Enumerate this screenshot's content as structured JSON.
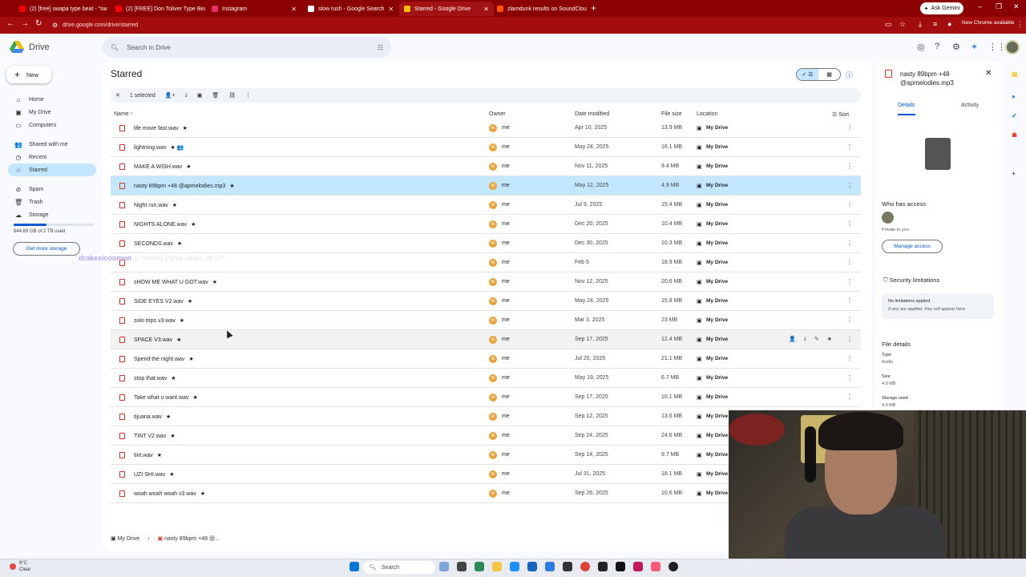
{
  "browser": {
    "tabs": [
      {
        "label": "(2) [free] swapa type beat - \"sw",
        "color": "#ff0000"
      },
      {
        "label": "(2) [FREE] Don Toliver Type Beat",
        "color": "#ff0000"
      },
      {
        "label": "Instagram",
        "color": "#e1306c"
      },
      {
        "label": "slow rush - Google Search",
        "color": "#ffffff"
      },
      {
        "label": "Starred - Google Drive",
        "color": "#fbbc04",
        "active": true
      },
      {
        "label": "zlamdunk results on SoundClou",
        "color": "#ff5500"
      }
    ],
    "ask_gemini": "Ask Gemini",
    "url": "drive.google.com/drive/starred",
    "new_chrome": "New Chrome available"
  },
  "drive": {
    "brand": "Drive",
    "search_placeholder": "Search in Drive",
    "new_label": "New",
    "nav": [
      {
        "label": "Home",
        "icon": "home-icon"
      },
      {
        "label": "My Drive",
        "icon": "my-drive-icon"
      },
      {
        "label": "Computers",
        "icon": "computers-icon"
      },
      {
        "label": "Shared with me",
        "icon": "shared-icon"
      },
      {
        "label": "Recent",
        "icon": "recent-icon"
      },
      {
        "label": "Starred",
        "icon": "star-icon",
        "active": true
      },
      {
        "label": "Spam",
        "icon": "spam-icon"
      },
      {
        "label": "Trash",
        "icon": "trash-icon"
      },
      {
        "label": "Storage",
        "icon": "storage-icon"
      }
    ],
    "storage_text": "844.69 GB of 2 TB used",
    "storage_fraction": 0.41,
    "get_more_storage": "Get more storage",
    "page_title": "Starred",
    "selection_count": "1 selected",
    "columns": {
      "name": "Name",
      "owner": "Owner",
      "date": "Date modified",
      "size": "File size",
      "location": "Location",
      "sort": "Sort"
    },
    "files": [
      {
        "name": "life move fast.wav",
        "star": "★",
        "owner": "me",
        "date": "Apr 10, 2025",
        "size": "13.9 MB",
        "location": "My Drive"
      },
      {
        "name": "lightning.wav",
        "star": "★  👥",
        "owner": "me",
        "date": "May 24, 2025",
        "size": "16.1 MB",
        "location": "My Drive"
      },
      {
        "name": "MAKE A WISH.wav",
        "star": "★",
        "owner": "me",
        "date": "Nov 11, 2025",
        "size": "9.4 MB",
        "location": "My Drive"
      },
      {
        "name": "nasty 89bpm +48 @apmelodies.mp3",
        "star": "★",
        "owner": "me",
        "date": "May 12, 2025",
        "size": "4.9 MB",
        "location": "My Drive",
        "selected": true
      },
      {
        "name": "Night run.wav",
        "star": "★",
        "owner": "me",
        "date": "Jul 9, 2025",
        "size": "15.4 MB",
        "location": "My Drive"
      },
      {
        "name": "NIGHTS ALONE.wav",
        "star": "★",
        "owner": "me",
        "date": "Dec 20, 2025",
        "size": "10.4 MB",
        "location": "My Drive"
      },
      {
        "name": "SECONDS.wav",
        "star": "★",
        "owner": "me",
        "date": "Dec 30, 2025",
        "size": "10.3 MB",
        "location": "My Drive"
      },
      {
        "name": "",
        "star": "",
        "owner": "me",
        "date": "Feb 5",
        "size": "18.9 MB",
        "location": "My Drive"
      },
      {
        "name": "sHOW ME WHAT U GOT.wav",
        "star": "★",
        "owner": "me",
        "date": "Nov 12, 2025",
        "size": "20.6 MB",
        "location": "My Drive"
      },
      {
        "name": "SIDE EYES V2.wav",
        "star": "★",
        "owner": "me",
        "date": "May 24, 2025",
        "size": "15.8 MB",
        "location": "My Drive"
      },
      {
        "name": "solo trips v3.wav",
        "star": "★",
        "owner": "me",
        "date": "Mar 3, 2025",
        "size": "23 MB",
        "location": "My Drive"
      },
      {
        "name": "SPACE V3.wav",
        "star": "★",
        "owner": "me",
        "date": "Sep 17, 2025",
        "size": "12.4 MB",
        "location": "My Drive",
        "hover": true
      },
      {
        "name": "Spend the night.wav",
        "star": "★",
        "owner": "me",
        "date": "Jul 20, 2025",
        "size": "21.1 MB",
        "location": "My Drive"
      },
      {
        "name": "stop that.wav",
        "star": "★",
        "owner": "me",
        "date": "May 19, 2025",
        "size": "6.7 MB",
        "location": "My Drive"
      },
      {
        "name": "Take what u want.wav",
        "star": "★",
        "owner": "me",
        "date": "Sep 17, 2025",
        "size": "10.1 MB",
        "location": "My Drive"
      },
      {
        "name": "tijuana.wav",
        "star": "★",
        "owner": "me",
        "date": "Sep 12, 2025",
        "size": "13.6 MB",
        "location": "My Drive"
      },
      {
        "name": "TINT V2.wav",
        "star": "★",
        "owner": "me",
        "date": "Sep 24, 2025",
        "size": "24.6 MB",
        "location": "My Drive"
      },
      {
        "name": "tint.wav",
        "star": "★",
        "owner": "me",
        "date": "Sep 14, 2025",
        "size": "9.7 MB",
        "location": "My Drive"
      },
      {
        "name": "UZI SHI.wav",
        "star": "★",
        "owner": "me",
        "date": "Jul 31, 2025",
        "size": "18.1 MB",
        "location": "My Drive"
      },
      {
        "name": "woah woah woah v3.wav",
        "star": "★",
        "owner": "me",
        "date": "Sep 26, 2025",
        "size": "10.6 MB",
        "location": "My Drive"
      }
    ],
    "breadcrumb": {
      "root": "My Drive",
      "file": "nasty 89bpm +48 @..."
    }
  },
  "details_panel": {
    "title": "nasty 89bpm +48 @apmelodies.mp3",
    "tab_details": "Details",
    "tab_activity": "Activity",
    "who_has_access": "Who has access",
    "private": "Private to you",
    "manage_access": "Manage access",
    "security_title": "Security limitations",
    "no_limits": "No limitations applied",
    "limits_hint": "If any are applied, they will appear here",
    "file_details": "File details",
    "type_label": "Type",
    "type_value": "Audio",
    "size_label": "Size",
    "size_value": "4.9 MB",
    "storage_label": "Storage used",
    "storage_value": "4.9 MB"
  },
  "overlay": {
    "chat_user": "drakesicooman",
    "chat_message": "U finding these beats off yt?"
  },
  "taskbar": {
    "weather_temp": "9°C",
    "weather_desc": "Clear",
    "search": "Search"
  }
}
